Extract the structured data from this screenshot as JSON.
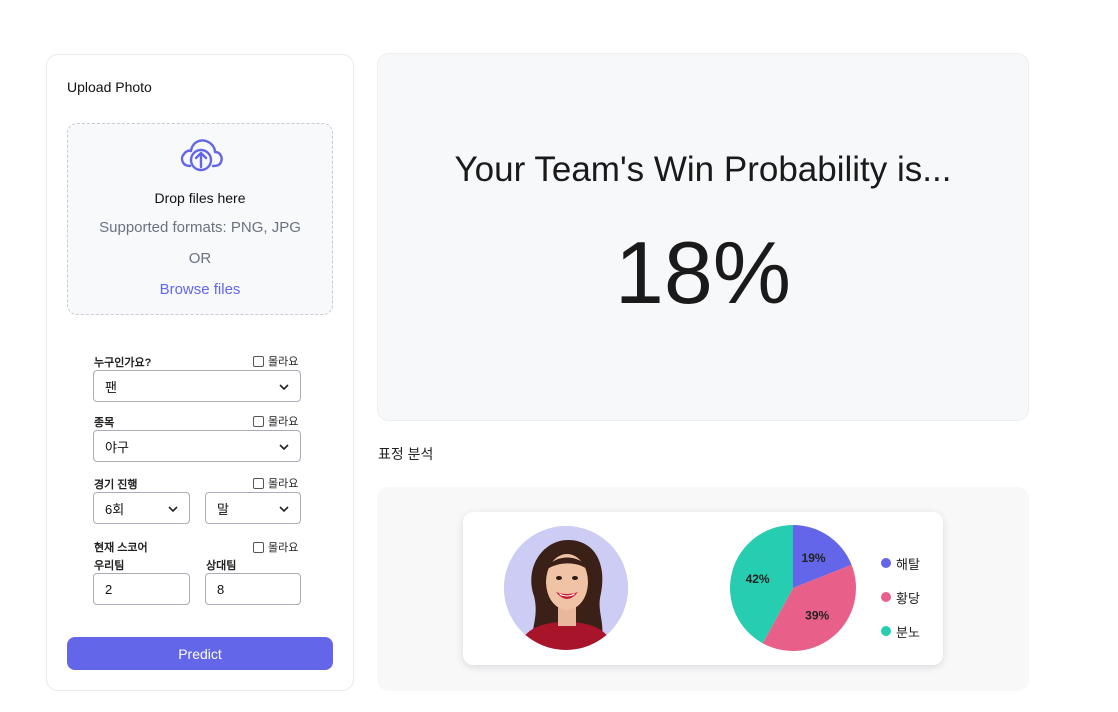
{
  "upload": {
    "title": "Upload Photo",
    "drop_text": "Drop files here",
    "formats": "Supported formats: PNG, JPG",
    "or": "OR",
    "browse": "Browse files"
  },
  "form": {
    "unknown_label": "몰라요",
    "who": {
      "label": "누구인가요?",
      "value": "팬"
    },
    "sport": {
      "label": "종목",
      "value": "야구"
    },
    "progress": {
      "label": "경기 진행",
      "inning": "6회",
      "half": "말"
    },
    "score": {
      "label": "현재 스코어",
      "our_label": "우리팀",
      "our_value": "2",
      "their_label": "상대팀",
      "their_value": "8"
    },
    "predict_label": "Predict"
  },
  "result": {
    "title": "Your Team's Win Probability is...",
    "value": "18%"
  },
  "analysis": {
    "section_label": "표정 분석",
    "chart_data": {
      "type": "pie",
      "slices": [
        {
          "name": "해탈",
          "value": 19,
          "label": "19%",
          "color": "#6366e8"
        },
        {
          "name": "황당",
          "value": 39,
          "label": "39%",
          "color": "#e8608a"
        },
        {
          "name": "분노",
          "value": 42,
          "label": "42%",
          "color": "#26cdb0"
        }
      ],
      "legend": "right"
    }
  },
  "colors": {
    "accent": "#6366e8",
    "result_bg": "#f7f8fa"
  }
}
